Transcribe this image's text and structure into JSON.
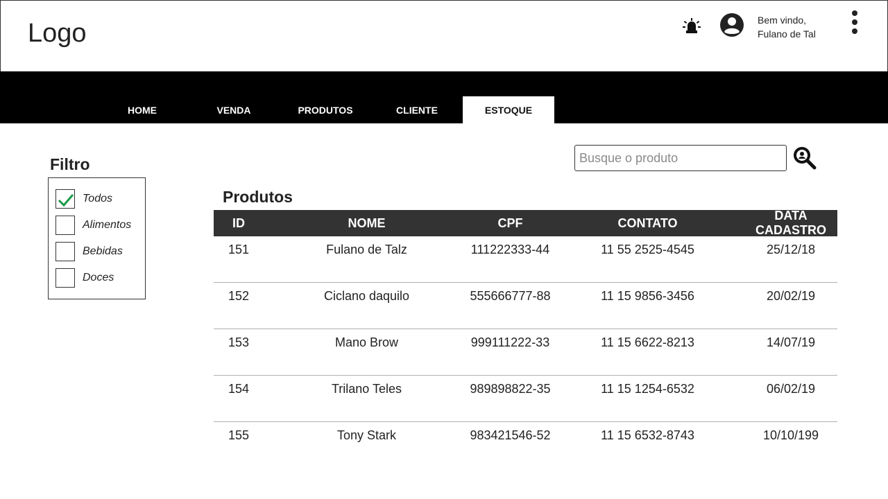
{
  "header": {
    "logo": "Logo",
    "welcome_line1": "Bem vindo,",
    "welcome_line2": "Fulano de Tal"
  },
  "nav": {
    "tabs": [
      {
        "label": "HOME",
        "active": false
      },
      {
        "label": "VENDA",
        "active": false
      },
      {
        "label": "PRODUTOS",
        "active": false
      },
      {
        "label": "CLIENTE",
        "active": false
      },
      {
        "label": "ESTOQUE",
        "active": true
      }
    ]
  },
  "filter": {
    "title": "Filtro",
    "items": [
      {
        "label": "Todos",
        "checked": true
      },
      {
        "label": "Alimentos",
        "checked": false
      },
      {
        "label": "Bebidas",
        "checked": false
      },
      {
        "label": "Doces",
        "checked": false
      }
    ]
  },
  "search": {
    "placeholder": "Busque o produto",
    "value": ""
  },
  "products": {
    "title": "Produtos",
    "columns": [
      "ID",
      "NOME",
      "CPF",
      "CONTATO",
      "DATA CADASTRO"
    ],
    "rows": [
      [
        "151",
        "Fulano de Talz",
        "111222333-44",
        "11 55 2525-4545",
        "25/12/18"
      ],
      [
        "152",
        "Ciclano daquilo",
        "555666777-88",
        "11 15 9856-3456",
        "20/02/19"
      ],
      [
        "153",
        "Mano Brow",
        "999111222-33",
        "11 15 6622-8213",
        "14/07/19"
      ],
      [
        "154",
        "Trilano Teles",
        "989898822-35",
        "11 15 1254-6532",
        "06/02/19"
      ],
      [
        "155",
        "Tony Stark",
        "983421546-52",
        "11 15 6532-8743",
        "10/10/199"
      ]
    ]
  },
  "colors": {
    "nav_background": "#000000",
    "table_header": "#333333",
    "check_mark": "#1a9a4a"
  },
  "icons": {
    "alarm": "alarm-icon",
    "avatar": "account-circle-icon",
    "menu": "more-vertical-icon",
    "search": "search-icon",
    "check": "check-icon"
  }
}
